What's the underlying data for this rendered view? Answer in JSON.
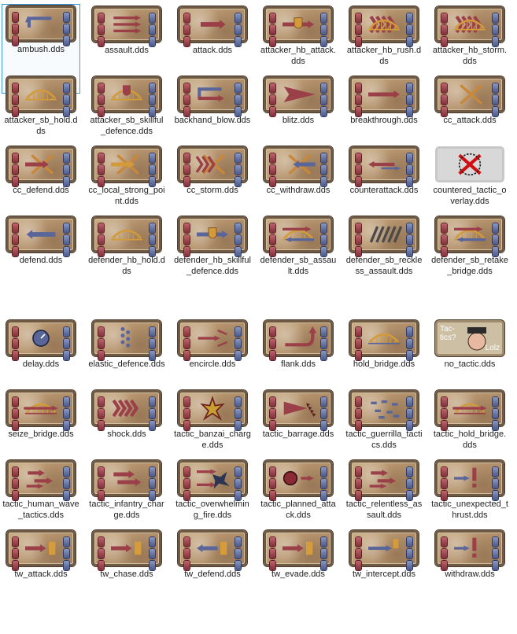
{
  "view": {
    "selected_index": 0,
    "colors": {
      "selection_border": "#3b9de0",
      "red_unit": "#9b3f48",
      "blue_unit": "#5a6699",
      "parchment": "#b79670",
      "gold": "#d39a3a"
    }
  },
  "files": [
    {
      "name": "ambush.dds",
      "icon": "ambush-icon"
    },
    {
      "name": "assault.dds",
      "icon": "assault-icon"
    },
    {
      "name": "attack.dds",
      "icon": "attack-icon"
    },
    {
      "name": "attacker_hb_attack.dds",
      "icon": "attacker-hb-attack-icon"
    },
    {
      "name": "attacker_hb_rush.dds",
      "icon": "attacker-hb-rush-icon"
    },
    {
      "name": "attacker_hb_storm.dds",
      "icon": "attacker-hb-storm-icon"
    },
    {
      "name": "attacker_sb_hold.dds",
      "icon": "attacker-sb-hold-icon"
    },
    {
      "name": "attacker_sb_skillful_defence.dds",
      "icon": "attacker-sb-skillful-defence-icon"
    },
    {
      "name": "backhand_blow.dds",
      "icon": "backhand-blow-icon"
    },
    {
      "name": "blitz.dds",
      "icon": "blitz-icon"
    },
    {
      "name": "breakthrough.dds",
      "icon": "breakthrough-icon"
    },
    {
      "name": "cc_attack.dds",
      "icon": "cc-attack-icon"
    },
    {
      "name": "cc_defend.dds",
      "icon": "cc-defend-icon"
    },
    {
      "name": "cc_local_strong_point.dds",
      "icon": "cc-local-strong-point-icon"
    },
    {
      "name": "cc_storm.dds",
      "icon": "cc-storm-icon"
    },
    {
      "name": "cc_withdraw.dds",
      "icon": "cc-withdraw-icon"
    },
    {
      "name": "counterattack.dds",
      "icon": "counterattack-icon"
    },
    {
      "name": "countered_tactic_overlay.dds",
      "icon": "countered-tactic-overlay-icon"
    },
    {
      "name": "defend.dds",
      "icon": "defend-icon"
    },
    {
      "name": "defender_hb_hold.dds",
      "icon": "defender-hb-hold-icon"
    },
    {
      "name": "defender_hb_skillful_defence.dds",
      "icon": "defender-hb-skillful-defence-icon"
    },
    {
      "name": "defender_sb_assault.dds",
      "icon": "defender-sb-assault-icon"
    },
    {
      "name": "defender_sb_reckless_assault.dds",
      "icon": "defender-sb-reckless-assault-icon"
    },
    {
      "name": "defender_sb_retake_bridge.dds",
      "icon": "defender-sb-retake-bridge-icon"
    },
    {
      "name": "delay.dds",
      "icon": "delay-icon"
    },
    {
      "name": "elastic_defence.dds",
      "icon": "elastic-defence-icon"
    },
    {
      "name": "encircle.dds",
      "icon": "encircle-icon"
    },
    {
      "name": "flank.dds",
      "icon": "flank-icon"
    },
    {
      "name": "hold_bridge.dds",
      "icon": "hold-bridge-icon"
    },
    {
      "name": "no_tactic.dds",
      "icon": "no-tactic-icon",
      "overlay_text": [
        "Tac-",
        "tics?",
        "Lolz"
      ]
    },
    {
      "name": "seize_bridge.dds",
      "icon": "seize-bridge-icon"
    },
    {
      "name": "shock.dds",
      "icon": "shock-icon"
    },
    {
      "name": "tactic_banzai_charge.dds",
      "icon": "tactic-banzai-charge-icon"
    },
    {
      "name": "tactic_barrage.dds",
      "icon": "tactic-barrage-icon"
    },
    {
      "name": "tactic_guerrilla_tactics.dds",
      "icon": "tactic-guerrilla-tactics-icon"
    },
    {
      "name": "tactic_hold_bridge.dds",
      "icon": "tactic-hold-bridge-icon"
    },
    {
      "name": "tactic_human_wave_tactics.dds",
      "icon": "tactic-human-wave-tactics-icon"
    },
    {
      "name": "tactic_infantry_charge.dds",
      "icon": "tactic-infantry-charge-icon"
    },
    {
      "name": "tactic_overwhelming_fire.dds",
      "icon": "tactic-overwhelming-fire-icon"
    },
    {
      "name": "tactic_planned_attack.dds",
      "icon": "tactic-planned-attack-icon"
    },
    {
      "name": "tactic_relentless_assault.dds",
      "icon": "tactic-relentless-assault-icon"
    },
    {
      "name": "tactic_unexpected_thrust.dds",
      "icon": "tactic-unexpected-thrust-icon"
    },
    {
      "name": "tw_attack.dds",
      "icon": "tw-attack-icon"
    },
    {
      "name": "tw_chase.dds",
      "icon": "tw-chase-icon"
    },
    {
      "name": "tw_defend.dds",
      "icon": "tw-defend-icon"
    },
    {
      "name": "tw_evade.dds",
      "icon": "tw-evade-icon"
    },
    {
      "name": "tw_intercept.dds",
      "icon": "tw-intercept-icon"
    },
    {
      "name": "withdraw.dds",
      "icon": "withdraw-icon"
    }
  ]
}
